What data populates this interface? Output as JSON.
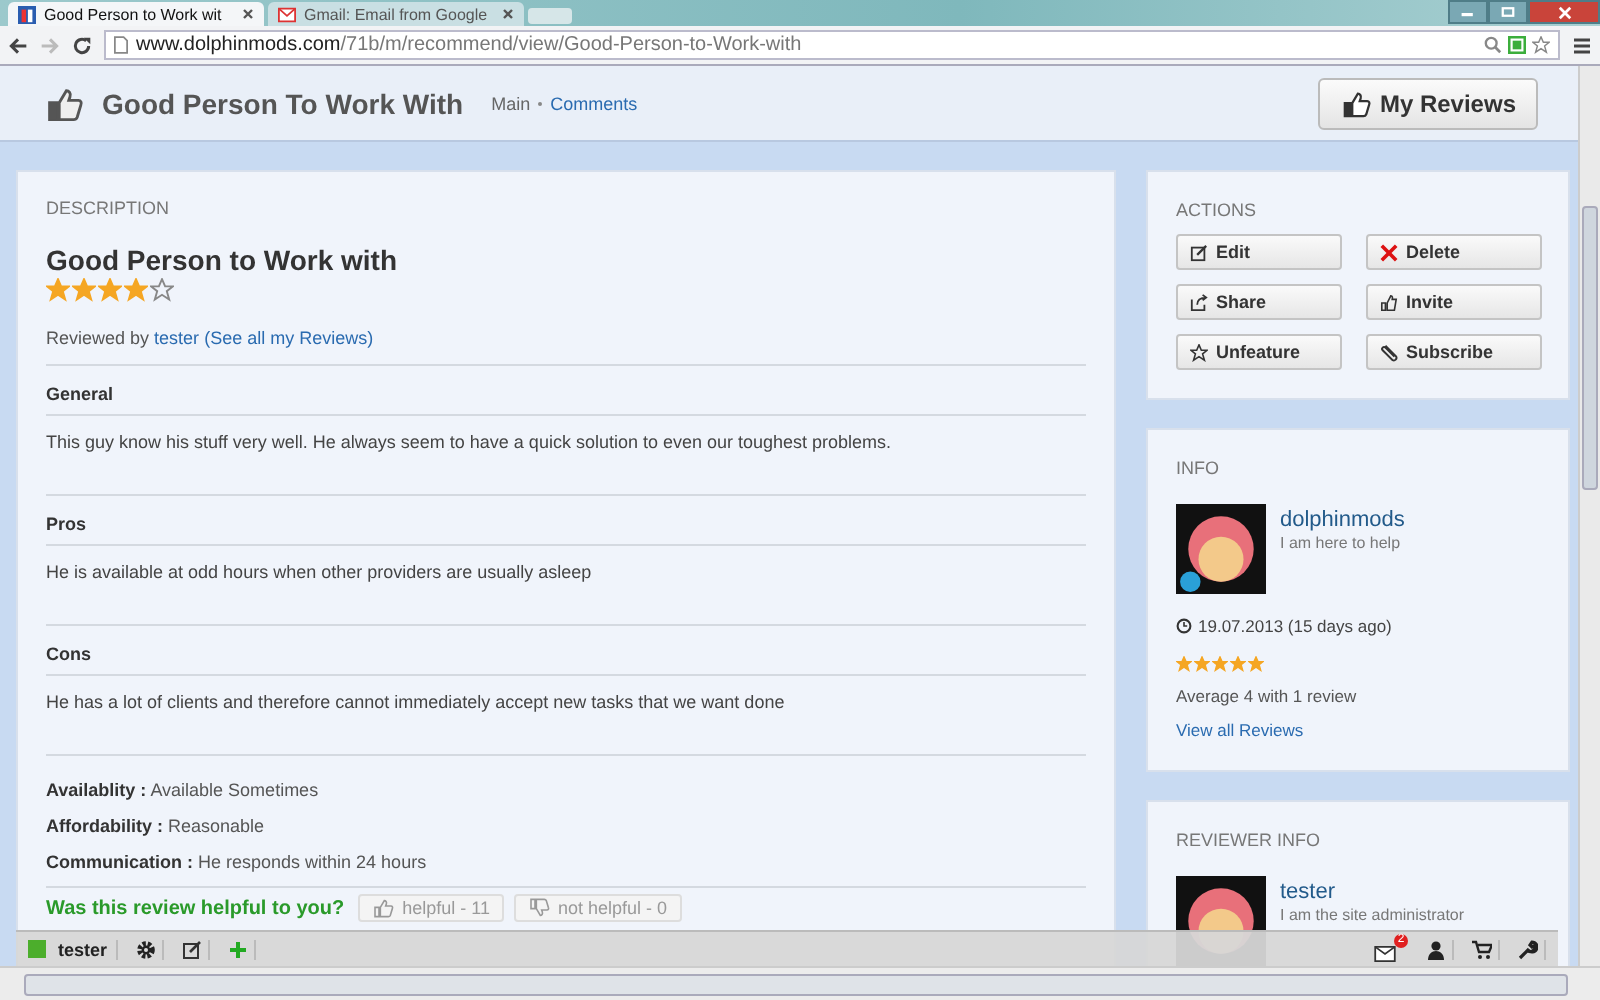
{
  "browser": {
    "tabs": [
      {
        "title": "Good Person to Work wit",
        "selected": true
      },
      {
        "title": "Gmail: Email from Google",
        "selected": false
      }
    ],
    "url": {
      "domain": "www.dolphinmods.com",
      "path": "/71b/m/recommend/view/Good-Person-to-Work-with"
    }
  },
  "header": {
    "title": "Good Person To Work With",
    "nav": [
      {
        "label": "Main",
        "selected": true
      },
      {
        "label": "Comments",
        "selected": false
      }
    ],
    "button": "My Reviews"
  },
  "description": {
    "heading": "DESCRIPTION",
    "title": "Good Person to Work with",
    "stars": 4,
    "reviewed_by": {
      "prefix": "Reviewed by",
      "user": "tester",
      "link": "(See all my Reviews)"
    },
    "sections": [
      {
        "heading": "General",
        "text": "This guy know his stuff very well. He always seem to have a quick solution to even our toughest problems."
      },
      {
        "heading": "Pros",
        "text": "He is available at odd hours when other providers are usually asleep"
      },
      {
        "heading": "Cons",
        "text": "He has a lot of clients and therefore cannot immediately accept new tasks that we want done"
      }
    ],
    "attributes": [
      {
        "label": "Availablity :",
        "value": "Available Sometimes"
      },
      {
        "label": "Affordability :",
        "value": "Reasonable"
      },
      {
        "label": "Communication :",
        "value": "He responds within 24 hours"
      }
    ],
    "helpful": {
      "question": "Was this review helpful to you?",
      "buttons": [
        {
          "label": "helpful - 11",
          "kind": "up"
        },
        {
          "label": "not helpful - 0",
          "kind": "down"
        }
      ]
    }
  },
  "actions": {
    "heading": "ACTIONS",
    "buttons": [
      {
        "label": "Edit"
      },
      {
        "label": "Delete"
      },
      {
        "label": "Share"
      },
      {
        "label": "Invite"
      },
      {
        "label": "Unfeature"
      },
      {
        "label": "Subscribe"
      }
    ]
  },
  "info": {
    "heading": "INFO",
    "name": "dolphinmods",
    "tagline": "I am here to help",
    "date": "19.07.2013 (15 days ago)",
    "stars": 5,
    "average": "Average 4 with 1 review",
    "link": "View all Reviews"
  },
  "reviewer": {
    "heading": "REVIEWER INFO",
    "name": "tester",
    "tagline": "I am the site administrator"
  },
  "toolbar": {
    "user": "tester",
    "notifications": "2"
  }
}
